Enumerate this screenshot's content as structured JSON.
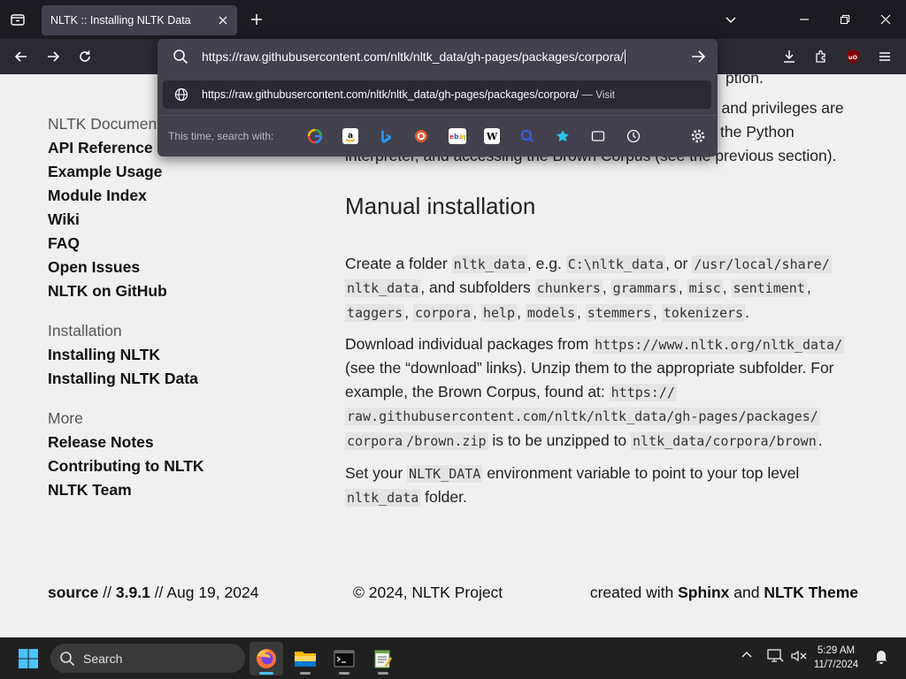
{
  "browser": {
    "tab_title": "NLTK :: Installing NLTK Data",
    "url": "https://raw.githubusercontent.com/nltk/nltk_data/gh-pages/packages/corpora/",
    "suggestion": {
      "url": "https://raw.githubusercontent.com/nltk/nltk_data/gh-pages/packages/corpora/",
      "separator": "—",
      "action": "Visit"
    },
    "search_with_label": "This time, search with:",
    "engines": [
      "Google",
      "Amazon",
      "Bing",
      "DuckDuckGo",
      "eBay",
      "Wikipedia",
      "Search",
      "Bookmarks",
      "Tabs",
      "History"
    ],
    "extension_badge": "uO"
  },
  "sidebar": {
    "partial_top": "NLTK Documen",
    "doc_links": [
      "API Reference",
      "Example Usage",
      "Module Index",
      "Wiki",
      "FAQ",
      "Open Issues",
      "NLTK on GitHub"
    ],
    "installation_title": "Installation",
    "installation_links": [
      "Installing NLTK",
      "Installing NLTK Data"
    ],
    "more_title": "More",
    "more_links": [
      "Release Notes",
      "Contributing to NLTK",
      "NLTK Team"
    ]
  },
  "content": {
    "partial_line1": "ption.",
    "partial_line2": "nt and privileges are",
    "partial_line3": "the Python",
    "partial_line4": "interpreter, and accessing the Brown Corpus (see the previous section).",
    "heading": "Manual installation",
    "p1": {
      "t1": "Create a folder ",
      "c1": "nltk_data",
      "t2": ", e.g. ",
      "c2": "C:\\nltk_data",
      "t3": ", or ",
      "c3a": "/usr/local/share/",
      "c3b": "nltk_data",
      "t4": ", and subfolders ",
      "c4": "chunkers",
      "c5": "grammars",
      "c6": "misc",
      "c7": "sentiment",
      "c8": "taggers",
      "c9": "corpora",
      "c10": "help",
      "c11": "models",
      "c12": "stemmers",
      "c13": "tokenizers",
      "comma": ",",
      "period": "."
    },
    "p2": {
      "t1": "Download individual packages from ",
      "c1": "https://www.nltk.org/nltk_data/",
      "t2": "(see the “download” links). Unzip them to the appropriate subfolder. For",
      "t3": "example, the Brown Corpus, found at: ",
      "c2a": "https://",
      "c2b": "raw.githubusercontent.com/nltk/nltk_data/gh-pages/packages/",
      "c2c": "corpora",
      "c2d": "/brown.zip",
      "t4": " is to be unzipped to ",
      "c3": "nltk_data/corpora/brown",
      "t5": "."
    },
    "p3": {
      "t1": "Set your ",
      "c1": "NLTK_DATA",
      "t2": " environment variable to point to your top level",
      "c2": "nltk_data",
      "t3": " folder."
    }
  },
  "footer": {
    "source_label": "source",
    "sep1": "//",
    "version": "3.9.1",
    "sep2": "//",
    "date": "Aug 19, 2024",
    "copyright": "© 2024, NLTK Project",
    "created_prefix": "created with",
    "sphinx": "Sphinx",
    "and": "and",
    "theme": "NLTK Theme"
  },
  "taskbar": {
    "search_label": "Search",
    "time": "5:29 AM",
    "date": "11/7/2024"
  }
}
